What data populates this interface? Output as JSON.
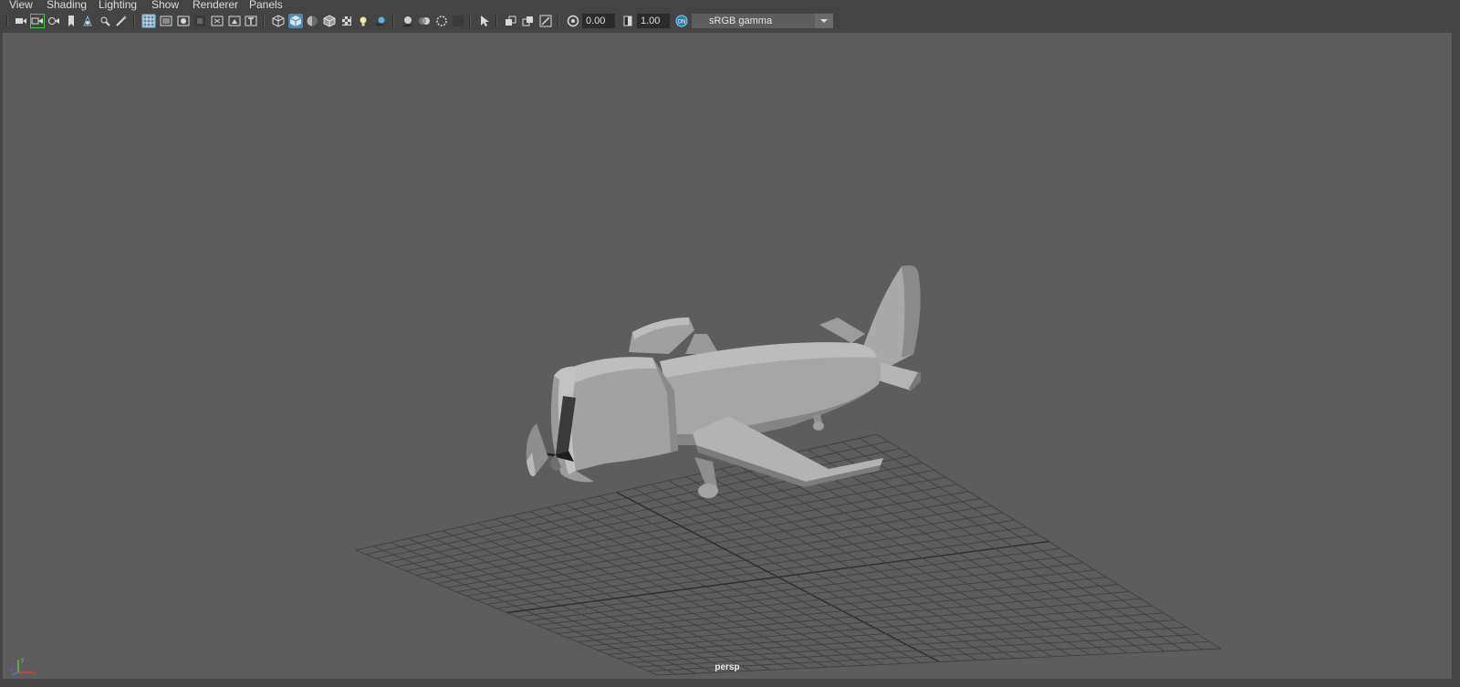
{
  "menu": {
    "items": [
      "View",
      "Shading",
      "Lighting",
      "Show",
      "Renderer",
      "Panels"
    ]
  },
  "toolbar": {
    "icons": [
      "select-camera-icon",
      "camera-attributes-icon",
      "bookmark-icon",
      "image-plane-icon",
      "2d-pan-zoom-icon",
      "grease-pencil-icon",
      "grid-icon",
      "film-gate-icon",
      "resolution-gate-icon",
      "gate-mask-icon",
      "field-chart-icon",
      "safe-action-icon",
      "safe-title-icon",
      "wireframe-icon",
      "smooth-shade-icon",
      "default-material-icon",
      "shaded-wireframe-icon",
      "textured-icon",
      "use-all-lights-icon",
      "shadows-icon",
      "screen-space-ao-icon",
      "motion-blur-icon",
      "anti-aliasing-icon",
      "depth-of-field-icon",
      "isolate-select-icon",
      "xray-icon",
      "xray-joints-icon",
      "xray-components-icon",
      "exposure-icon",
      "gamma-icon",
      "color-management-icon"
    ],
    "exposure_value": "0.00",
    "gamma_value": "1.00",
    "colorspace": "sRGB gamma"
  },
  "viewport": {
    "camera_label": "persp",
    "background": "#5d5d5d",
    "axis_labels": {
      "x": "x",
      "y": "y",
      "z": "z"
    }
  },
  "colors": {
    "active_button": "#5285a6",
    "highlight_outline": "#3ccf3c",
    "grid_line": "#3f3f3f",
    "grid_axis": "#2c2c2c",
    "model_light": "#b4b4b4",
    "model_mid": "#8e8e8e",
    "model_dark": "#5f5f5f"
  }
}
